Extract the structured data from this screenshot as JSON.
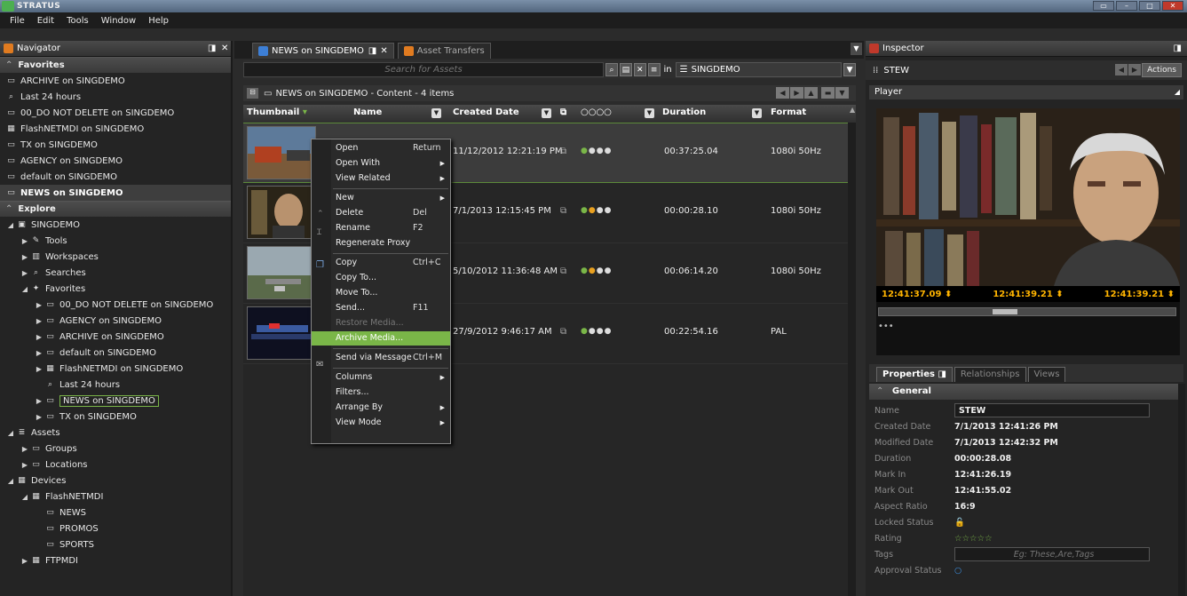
{
  "window": {
    "title": "STRATUS"
  },
  "menubar": [
    "File",
    "Edit",
    "Tools",
    "Window",
    "Help"
  ],
  "navigator": {
    "title": "Navigator",
    "favorites_header": "Favorites",
    "favorites": [
      {
        "label": "ARCHIVE on SINGDEMO",
        "icon": "folder-icon"
      },
      {
        "label": "Last 24 hours",
        "icon": "search-icon"
      },
      {
        "label": "00_DO NOT DELETE on SINGDEMO",
        "icon": "folder-icon"
      },
      {
        "label": "FlashNETMDI on SINGDEMO",
        "icon": "device-icon"
      },
      {
        "label": "TX on SINGDEMO",
        "icon": "folder-icon"
      },
      {
        "label": "AGENCY on SINGDEMO",
        "icon": "folder-icon"
      },
      {
        "label": "default on SINGDEMO",
        "icon": "folder-icon"
      },
      {
        "label": "NEWS on SINGDEMO",
        "icon": "folder-icon",
        "selected": true
      }
    ],
    "explore_header": "Explore",
    "tree": [
      {
        "label": "SINGDEMO",
        "depth": 0,
        "tri": "◢",
        "icon": "server-icon"
      },
      {
        "label": "Tools",
        "depth": 1,
        "tri": "▶",
        "icon": "tools-icon"
      },
      {
        "label": "Workspaces",
        "depth": 1,
        "tri": "▶",
        "icon": "workspace-icon"
      },
      {
        "label": "Searches",
        "depth": 1,
        "tri": "▶",
        "icon": "search-icon"
      },
      {
        "label": "Favorites",
        "depth": 1,
        "tri": "◢",
        "icon": "favorites-icon"
      },
      {
        "label": "00_DO NOT DELETE on SINGDEMO",
        "depth": 2,
        "tri": "▶",
        "icon": "folder-icon"
      },
      {
        "label": "AGENCY on SINGDEMO",
        "depth": 2,
        "tri": "▶",
        "icon": "folder-icon"
      },
      {
        "label": "ARCHIVE on SINGDEMO",
        "depth": 2,
        "tri": "▶",
        "icon": "folder-icon"
      },
      {
        "label": "default on SINGDEMO",
        "depth": 2,
        "tri": "▶",
        "icon": "folder-icon"
      },
      {
        "label": "FlashNETMDI on SINGDEMO",
        "depth": 2,
        "tri": "▶",
        "icon": "device-icon"
      },
      {
        "label": "Last 24 hours",
        "depth": 2,
        "tri": "",
        "icon": "search-icon"
      },
      {
        "label": "NEWS on SINGDEMO",
        "depth": 2,
        "tri": "▶",
        "icon": "folder-icon",
        "boxed": true
      },
      {
        "label": "TX on SINGDEMO",
        "depth": 2,
        "tri": "▶",
        "icon": "folder-icon"
      },
      {
        "label": "Assets",
        "depth": 0,
        "tri": "◢",
        "icon": "assets-icon"
      },
      {
        "label": "Groups",
        "depth": 1,
        "tri": "▶",
        "icon": "folder-icon"
      },
      {
        "label": "Locations",
        "depth": 1,
        "tri": "▶",
        "icon": "folder-icon"
      },
      {
        "label": "Devices",
        "depth": 0,
        "tri": "◢",
        "icon": "device-icon"
      },
      {
        "label": "FlashNETMDI",
        "depth": 1,
        "tri": "◢",
        "icon": "device-icon"
      },
      {
        "label": "NEWS",
        "depth": 2,
        "tri": "",
        "icon": "folder-icon"
      },
      {
        "label": "PROMOS",
        "depth": 2,
        "tri": "",
        "icon": "folder-icon"
      },
      {
        "label": "SPORTS",
        "depth": 2,
        "tri": "",
        "icon": "folder-icon"
      },
      {
        "label": "FTPMDI",
        "depth": 1,
        "tri": "▶",
        "icon": "device-icon"
      }
    ]
  },
  "center": {
    "tabs": [
      {
        "label": "NEWS on SINGDEMO",
        "active": true
      },
      {
        "label": "Asset Transfers",
        "active": false
      }
    ],
    "search_placeholder": "Search for Assets",
    "search_scope_prefix": "in",
    "search_scope": "SINGDEMO",
    "content_title": "NEWS on SINGDEMO  -  Content  -  4 items",
    "columns": [
      "Thumbnail",
      "Name",
      "Created Date",
      "○○○○",
      "Duration",
      "Format"
    ],
    "rows": [
      {
        "created": "11/12/2012 12:21:19 PM",
        "duration": "00:37:25.04",
        "format": "1080i 50Hz",
        "selected": true
      },
      {
        "created": "7/1/2013 12:15:45 PM",
        "duration": "00:00:28.10",
        "format": "1080i 50Hz"
      },
      {
        "created": "5/10/2012 11:36:48 AM",
        "duration": "00:06:14.20",
        "format": "1080i 50Hz"
      },
      {
        "created": "27/9/2012 9:46:17 AM",
        "duration": "00:22:54.16",
        "format": "PAL"
      }
    ]
  },
  "context_menu": {
    "items": [
      {
        "label": "Open",
        "shortcut": "Return"
      },
      {
        "label": "Open With",
        "submenu": true
      },
      {
        "label": "View Related",
        "submenu": true
      },
      {
        "sep": true
      },
      {
        "label": "New",
        "submenu": true
      },
      {
        "label": "Delete",
        "shortcut": "Del"
      },
      {
        "label": "Rename",
        "shortcut": "F2"
      },
      {
        "label": "Regenerate Proxy"
      },
      {
        "sep": true
      },
      {
        "label": "Copy",
        "shortcut": "Ctrl+C"
      },
      {
        "label": "Copy To..."
      },
      {
        "label": "Move To..."
      },
      {
        "label": "Send...",
        "shortcut": "F11"
      },
      {
        "label": "Restore Media...",
        "disabled": true
      },
      {
        "label": "Archive Media...",
        "highlight": true
      },
      {
        "sep": true
      },
      {
        "label": "Send via Message",
        "shortcut": "Ctrl+M"
      },
      {
        "sep": true
      },
      {
        "label": "Columns",
        "submenu": true
      },
      {
        "label": "Filters..."
      },
      {
        "label": "Arrange By",
        "submenu": true
      },
      {
        "label": "View Mode",
        "submenu": true
      }
    ]
  },
  "inspector": {
    "title": "Inspector",
    "asset_name": "STEW",
    "actions_label": "Actions",
    "player_label": "Player",
    "timecodes": [
      "12:41:37.09 ⬍",
      "12:41:39.21 ⬍",
      "12:41:39.21 ⬍"
    ],
    "tabs": [
      "Properties",
      "Relationships",
      "Views"
    ],
    "general_header": "General",
    "properties": [
      {
        "label": "Name",
        "value": "STEW",
        "input": true
      },
      {
        "label": "Created Date",
        "value": "7/1/2013 12:41:26 PM"
      },
      {
        "label": "Modified Date",
        "value": "7/1/2013 12:42:32 PM"
      },
      {
        "label": "Duration",
        "value": "00:00:28.08"
      },
      {
        "label": "Mark In",
        "value": "12:41:26.19"
      },
      {
        "label": "Mark Out",
        "value": "12:41:55.02"
      },
      {
        "label": "Aspect Ratio",
        "value": "16:9"
      },
      {
        "label": "Locked Status",
        "value": "🔓"
      },
      {
        "label": "Rating",
        "value": "☆☆☆☆☆"
      },
      {
        "label": "Tags",
        "placeholder": "Eg: These,Are,Tags",
        "input": true
      },
      {
        "label": "Approval Status",
        "value": "○"
      }
    ]
  },
  "colors": {
    "accent": "#7ab648",
    "timecode": "#ffb400"
  }
}
